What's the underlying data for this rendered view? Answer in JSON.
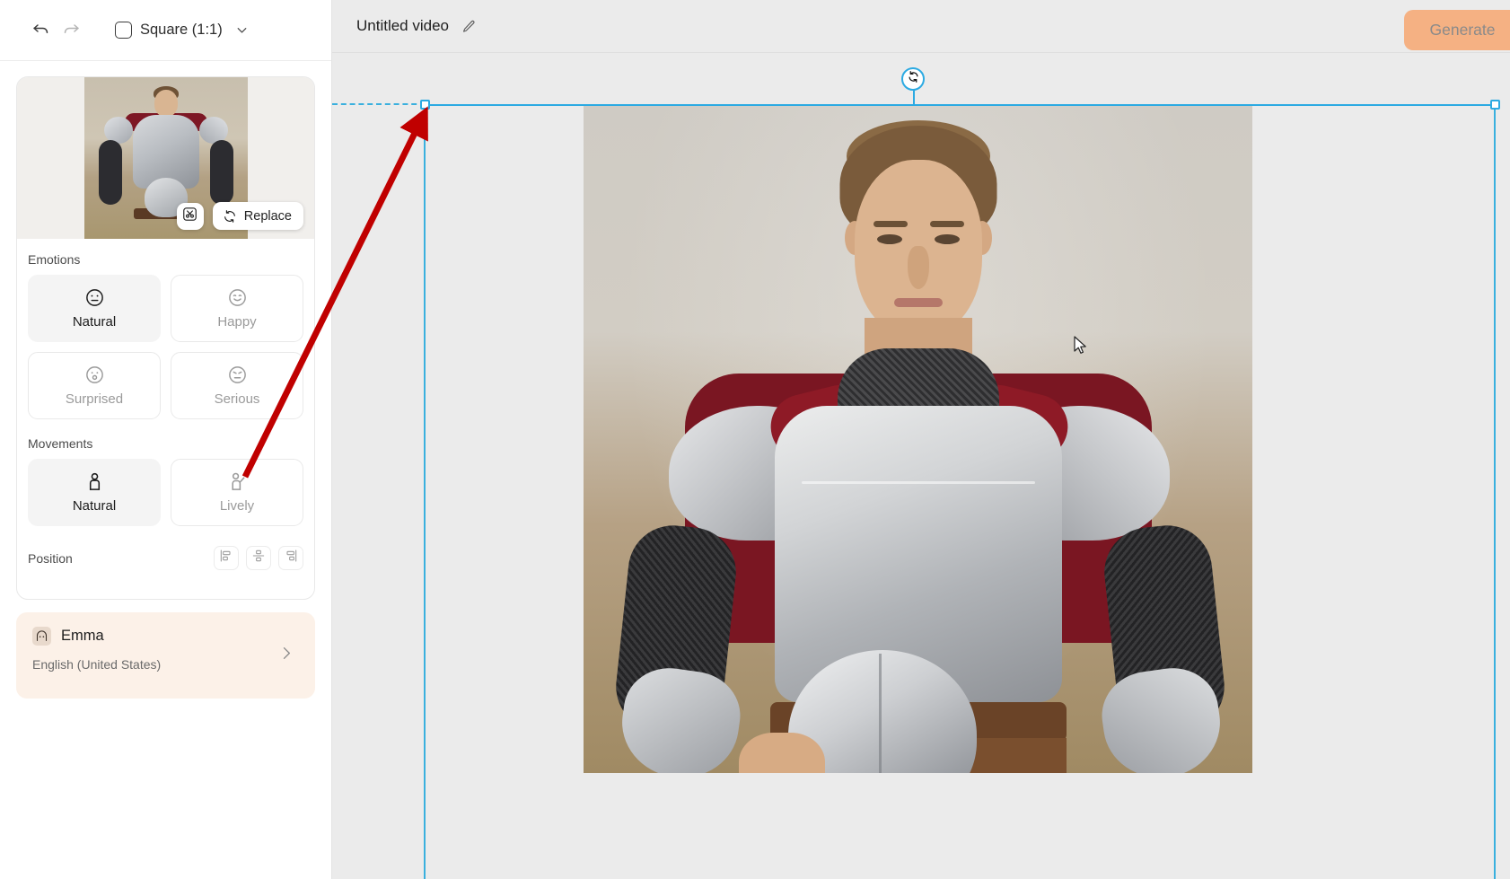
{
  "left_panel": {
    "toolbar": {
      "undo_icon": "undo-icon",
      "redo_icon": "redo-icon",
      "aspect_ratio_label": "Square (1:1)",
      "aspect_ratio_icon": "square-icon",
      "chevron_icon": "chevron-down-icon"
    },
    "thumbnail": {
      "cut_button_icon": "cut-scissors-icon",
      "replace_label": "Replace",
      "replace_icon": "refresh-icon"
    },
    "emotions": {
      "label": "Emotions",
      "options": [
        {
          "label": "Natural",
          "icon": "face-neutral-icon",
          "selected": true
        },
        {
          "label": "Happy",
          "icon": "face-smile-icon",
          "selected": false
        },
        {
          "label": "Surprised",
          "icon": "face-surprised-icon",
          "selected": false
        },
        {
          "label": "Serious",
          "icon": "face-serious-icon",
          "selected": false
        }
      ]
    },
    "movements": {
      "label": "Movements",
      "options": [
        {
          "label": "Natural",
          "icon": "person-standing-icon",
          "selected": true
        },
        {
          "label": "Lively",
          "icon": "person-waving-icon",
          "selected": false
        }
      ]
    },
    "position": {
      "label": "Position",
      "buttons": [
        {
          "name": "align-left",
          "icon": "align-left-icon"
        },
        {
          "name": "align-center",
          "icon": "align-center-icon"
        },
        {
          "name": "align-right",
          "icon": "align-right-icon"
        }
      ]
    },
    "voice": {
      "name": "Emma",
      "language": "English (United States)",
      "avatar_icon": "avatar-icon",
      "chevron_icon": "chevron-right-icon"
    }
  },
  "canvas": {
    "title": "Untitled video",
    "edit_icon": "pencil-icon",
    "generate_label": "Generate",
    "generate_color": "#f5b183",
    "selection": {
      "accent_color": "#2caae2",
      "rotate_icon": "rotate-icon",
      "handle_top_left": "resize-handle",
      "handle_top_right": "resize-handle"
    },
    "cursor_icon": "mouse-pointer-icon",
    "annotation": {
      "arrow_color": "#c00000",
      "arrow_icon": "annotation-arrow-icon"
    }
  }
}
